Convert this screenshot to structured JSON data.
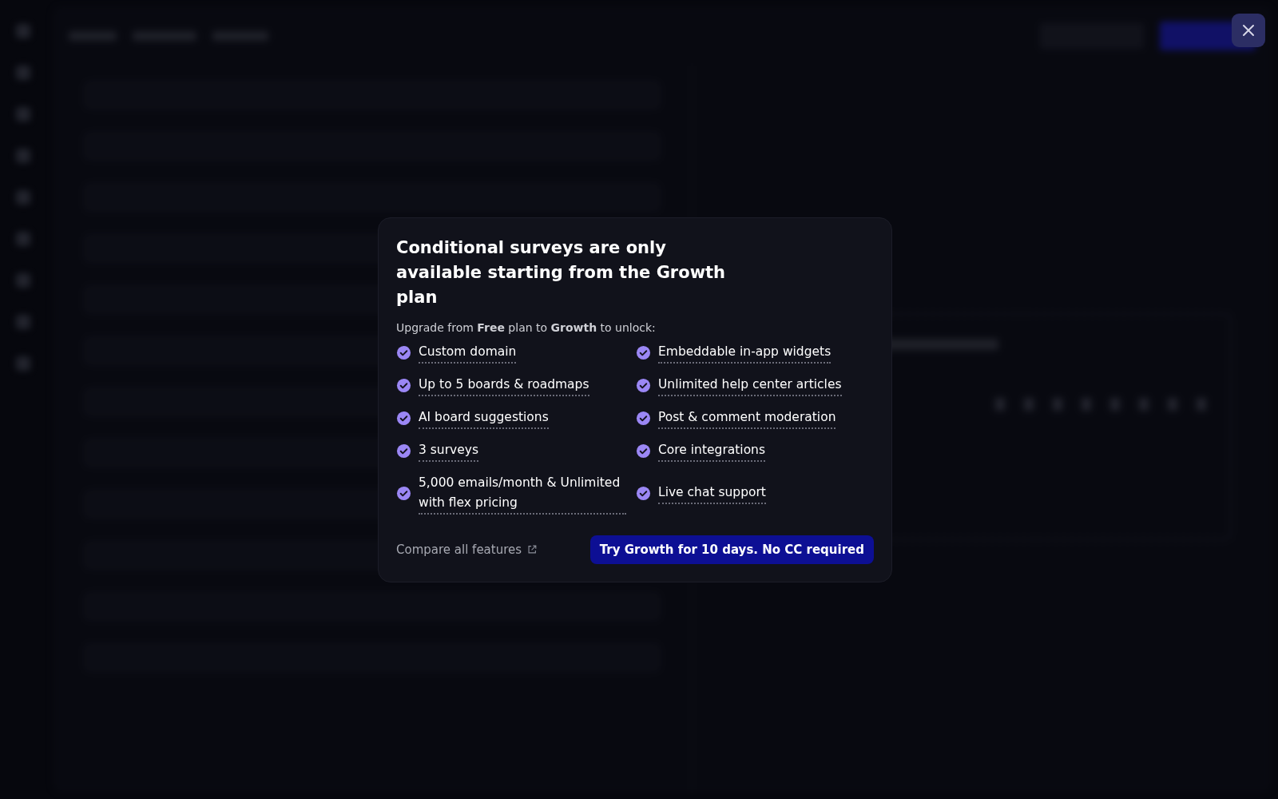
{
  "dialog": {
    "title": "Conditional surveys are only available starting from the Growth plan",
    "subtitle": "Upgrade from **Free** plan to **Growth** to unlock:",
    "features": [
      "Custom domain",
      "Up to 5 boards & roadmaps",
      "AI board suggestions",
      "3 surveys",
      "5,000 emails/month & Unlimited with flex pricing",
      "Embeddable in-app widgets",
      "Unlimited help center articles",
      "Post & comment moderation",
      "Core integrations",
      "Live chat support"
    ],
    "compare_link": "Compare all features",
    "cta_button": "Try Growth for 10 days. No CC required"
  },
  "close_button": {
    "kind": "close"
  }
}
